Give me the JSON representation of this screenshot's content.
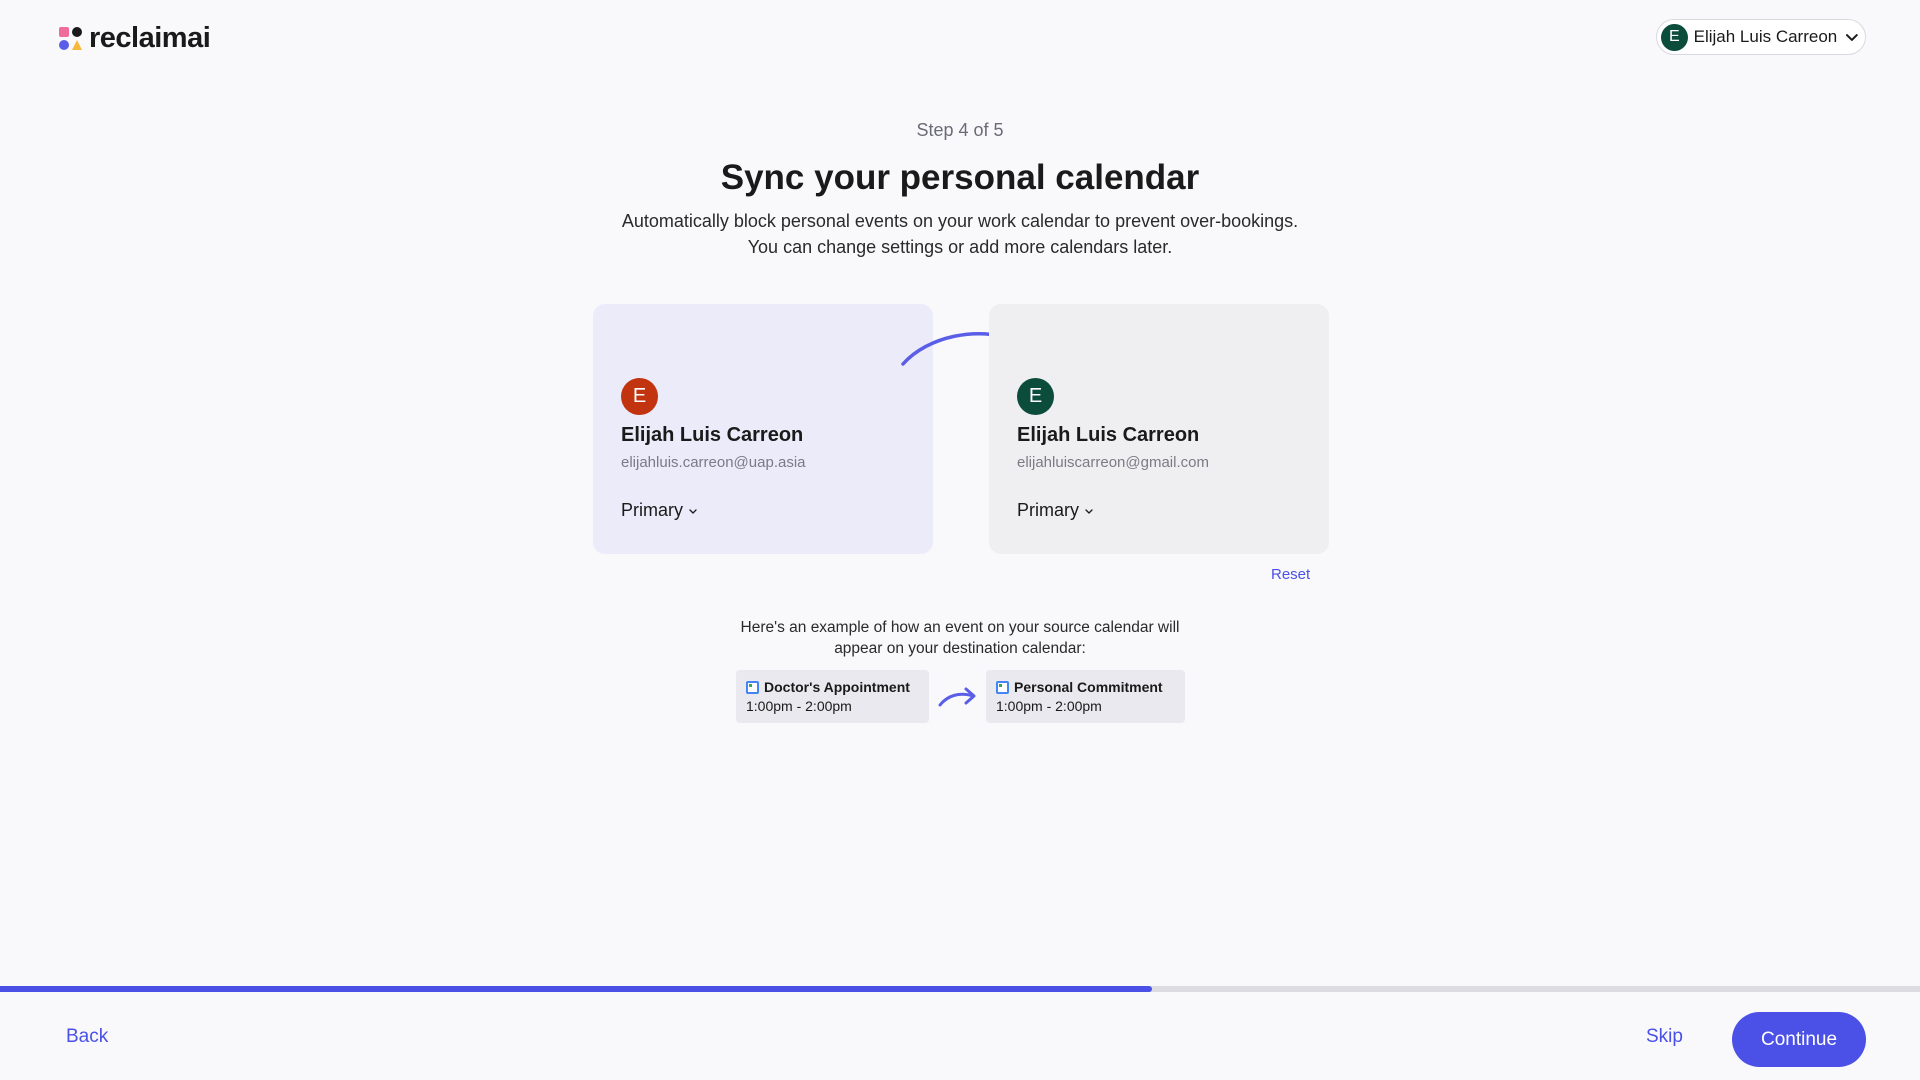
{
  "brand": {
    "name": "reclaimai"
  },
  "account": {
    "initial": "E",
    "name": "Elijah Luis Carreon"
  },
  "onboarding": {
    "step_label": "Step 4 of 5",
    "title": "Sync your personal calendar",
    "subtitle": "Automatically block personal events on your work calendar to prevent over-bookings. You can change settings or add more calendars later."
  },
  "source_card": {
    "initial": "E",
    "name": "Elijah Luis Carreon",
    "email": "elijahluis.carreon@uap.asia",
    "calendar": "Primary"
  },
  "destination_card": {
    "initial": "E",
    "name": "Elijah Luis Carreon",
    "email": "elijahluiscarreon@gmail.com",
    "calendar": "Primary"
  },
  "reset_label": "Reset",
  "example": {
    "text": "Here's an example of how an event on your source calendar will appear on your destination calendar:",
    "source_event": {
      "title": "Doctor's Appointment",
      "time": "1:00pm - 2:00pm"
    },
    "destination_event": {
      "title": "Personal Commitment",
      "time": "1:00pm - 2:00pm"
    }
  },
  "progress": {
    "fraction": 0.6
  },
  "footer": {
    "back": "Back",
    "skip": "Skip",
    "continue": "Continue"
  },
  "colors": {
    "accent": "#4b50e6",
    "source_avatar": "#c1340f",
    "dest_avatar": "#0b4d3a"
  }
}
